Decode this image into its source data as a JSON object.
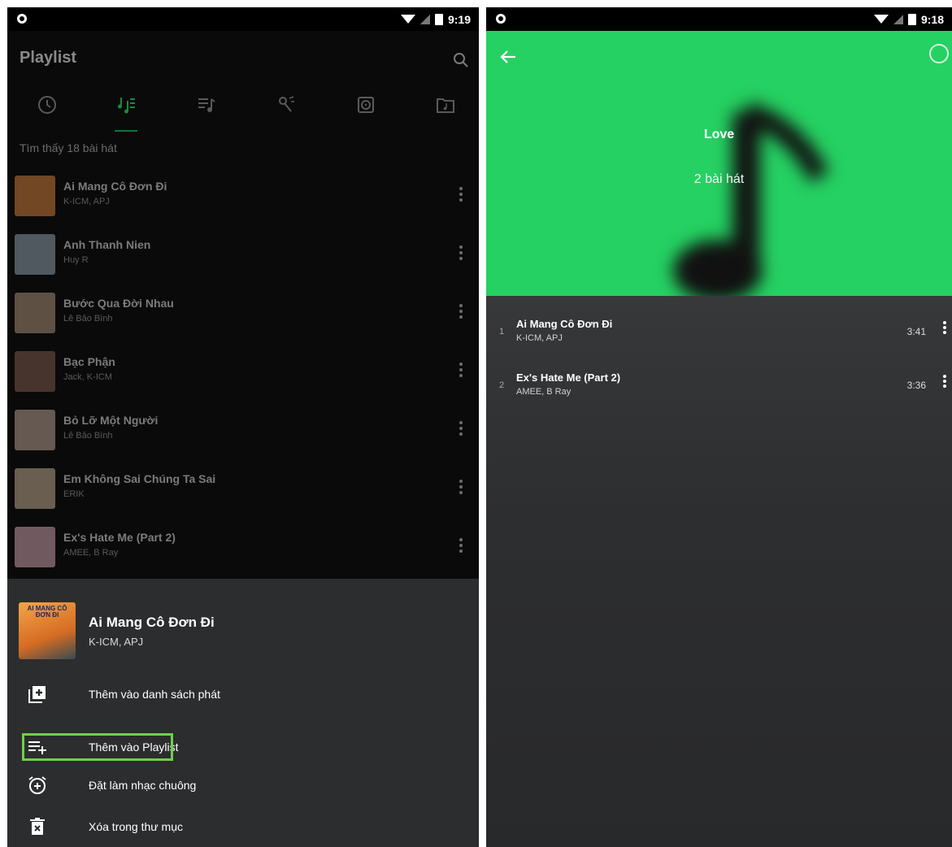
{
  "left": {
    "status": {
      "time": "9:19"
    },
    "title": "Playlist",
    "found_text": "Tìm thấy 18 bài hát",
    "songs": [
      {
        "name": "Ai Mang Cô Đơn Đi",
        "artist": "K-ICM, APJ",
        "thumb": "#c97a3a"
      },
      {
        "name": "Anh Thanh Nien",
        "artist": "Huy R",
        "thumb": "#8a9aa8"
      },
      {
        "name": "Bước Qua Đời Nhau",
        "artist": "Lê Bảo Bình",
        "thumb": "#a58a74"
      },
      {
        "name": "Bạc Phận",
        "artist": "Jack, K-ICM",
        "thumb": "#7a5a4a"
      },
      {
        "name": "Bỏ Lỡ Một Người",
        "artist": "Lê Bảo Bình",
        "thumb": "#b39a8c"
      },
      {
        "name": "Em Không Sai Chúng Ta Sai",
        "artist": "ERIK",
        "thumb": "#b8a48a"
      },
      {
        "name": "Ex's Hate Me (Part 2)",
        "artist": "AMEE, B Ray",
        "thumb": "#c79aa8"
      }
    ],
    "sheet": {
      "song_name": "Ai Mang Cô Đơn Đi",
      "artist": "K-ICM, APJ",
      "cover_text": "AI MANG CÔ ĐƠN ĐI",
      "actions": [
        {
          "label": "Thêm vào danh sách phát",
          "icon": "add-to-queue-icon"
        },
        {
          "label": "Thêm vào Playlist",
          "icon": "playlist-add-icon"
        },
        {
          "label": "Đặt làm nhạc chuông",
          "icon": "alarm-add-icon"
        },
        {
          "label": "Xóa trong thư mục",
          "icon": "delete-icon"
        }
      ]
    }
  },
  "right": {
    "status": {
      "time": "9:18"
    },
    "playlist_title": "Love",
    "song_count": "2 bài hát",
    "tracks": [
      {
        "num": "1",
        "name": "Ai Mang Cô Đơn Đi",
        "artist": "K-ICM, APJ",
        "duration": "3:41"
      },
      {
        "num": "2",
        "name": "Ex's Hate Me (Part 2)",
        "artist": "AMEE, B Ray",
        "duration": "3:36"
      }
    ]
  },
  "colors": {
    "accent": "#25d162",
    "highlight": "#6fcf4a"
  }
}
